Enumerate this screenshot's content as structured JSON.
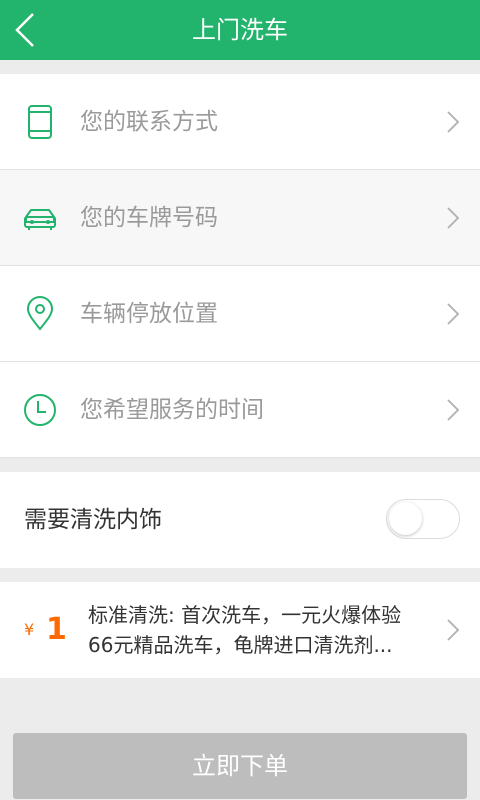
{
  "header": {
    "title": "上门洗车",
    "back_icon": "chevron-left-icon"
  },
  "rows": [
    {
      "label": "您的联系方式",
      "icon": "phone-icon"
    },
    {
      "label": "您的车牌号码",
      "icon": "car-icon"
    },
    {
      "label": "车辆停放位置",
      "icon": "location-pin-icon"
    },
    {
      "label": "您希望服务的时间",
      "icon": "clock-icon"
    }
  ],
  "interior": {
    "label": "需要清洗内饰",
    "enabled": false
  },
  "package": {
    "currency": "¥",
    "price": "1",
    "line1": "标准清洗: 首次洗车，一元火爆体验",
    "line2": "66元精品洗车，龟牌进口清洗剂..."
  },
  "order_button": "立即下单",
  "colors": {
    "primary": "#22b46c",
    "price": "#ff6a00",
    "button_disabled": "#bdbdbd"
  }
}
